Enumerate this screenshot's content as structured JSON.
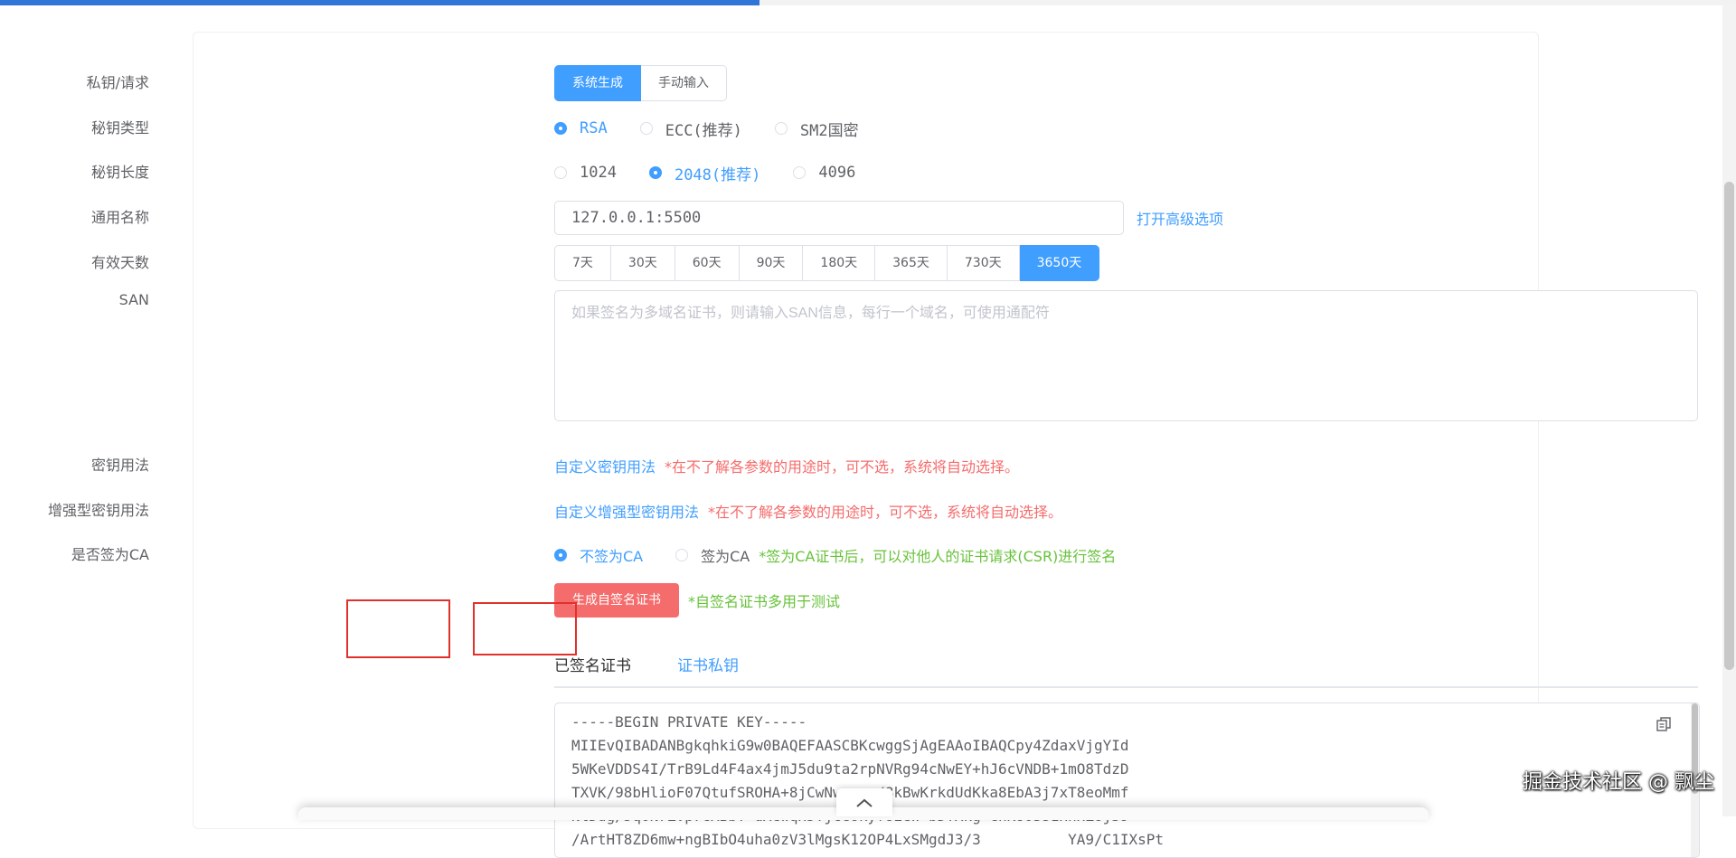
{
  "page": {
    "progress_fraction": 0.4375
  },
  "form": {
    "private_key_request": {
      "label": "私钥/请求",
      "options": [
        "系统生成",
        "手动输入"
      ],
      "selected": "系统生成"
    },
    "key_type": {
      "label": "秘钥类型",
      "options": [
        "RSA",
        "ECC(推荐)",
        "SM2国密"
      ],
      "selected": "RSA"
    },
    "key_length": {
      "label": "秘钥长度",
      "options": [
        "1024",
        "2048(推荐)",
        "4096"
      ],
      "selected": "2048(推荐)"
    },
    "common_name": {
      "label": "通用名称",
      "value": "127.0.0.1:5500",
      "advanced_link": "打开高级选项"
    },
    "validity_days": {
      "label": "有效天数",
      "options": [
        "7天",
        "30天",
        "60天",
        "90天",
        "180天",
        "365天",
        "730天",
        "3650天"
      ],
      "selected": "3650天"
    },
    "san": {
      "label": "SAN",
      "placeholder": "如果签名为多域名证书，则请输入SAN信息，每行一个域名，可使用通配符",
      "value": ""
    },
    "key_usage": {
      "label": "密钥用法",
      "link": "自定义密钥用法",
      "note": "*在不了解各参数的用途时，可不选，系统将自动选择。"
    },
    "ext_key_usage": {
      "label": "增强型密钥用法",
      "link": "自定义增强型密钥用法",
      "note": "*在不了解各参数的用途时，可不选，系统将自动选择。"
    },
    "sign_as_ca": {
      "label": "是否签为CA",
      "options": [
        "不签为CA",
        "签为CA"
      ],
      "selected": "不签为CA",
      "note": "*签为CA证书后，可以对他人的证书请求(CSR)进行签名"
    },
    "generate": {
      "button": "生成自签名证书",
      "note": "*自签名证书多用于测试"
    }
  },
  "tabs": {
    "items": [
      "已签名证书",
      "证书私钥"
    ],
    "active": "已签名证书"
  },
  "output": {
    "lines": [
      "-----BEGIN PRIVATE KEY-----",
      "MIIEvQIBADANBgkqhkiG9w0BAQEFAASCBKcwggSjAgEAAoIBAQCpy4ZdaxVjgYId",
      "5WKeVDDS4I/TrB9Ld4F4ax4jmJ5du9ta2rpNVRg94cNwEY+hJ6cVNDB+1mO8TdzD",
      "TXVK/98bHlioF07QtufSROHA+8jCwNwvonq/8kBwKrkdUdKka8EbA3j7xT8eoMmf",
      "NlDdg/Jq0N7Zvp7GXBbY+dXCwqHJYjceokyfUEeW+bDTXkg+ChKO03s1HnxZoj39",
      "/ArtHT8ZD6mw+ngBIbO4uha0zV3lMgsK12OP4LxSMgdJ3/3          YA9/C1IXsPt"
    ]
  },
  "watermark": "掘金技术社区 @ 飘尘",
  "icons": {
    "copy": "copy-icon",
    "collapse": "chevron-up-icon"
  },
  "colors": {
    "primary": "#409eff",
    "danger": "#f56c6c",
    "success": "#67c23a",
    "highlight": "#e0312c"
  }
}
